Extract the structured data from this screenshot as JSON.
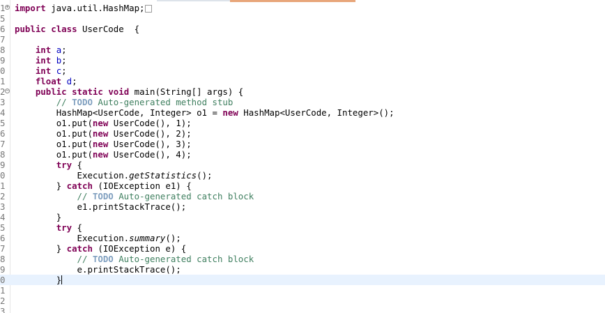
{
  "editor": {
    "line_numbers": [
      "1",
      "5",
      "6",
      "7",
      "8",
      "9",
      "0",
      "1",
      "2",
      "3",
      "4",
      "5",
      "6",
      "7",
      "8",
      "9",
      "0",
      "1",
      "2",
      "3",
      "4",
      "5",
      "6",
      "7",
      "8",
      "9",
      "0",
      "1",
      "2",
      "3"
    ],
    "fold_markers": {
      "expand": "+",
      "collapse": "−"
    },
    "current_line_index": 27,
    "code": {
      "l1": {
        "import_kw": "import",
        "import_path": " java.util.HashMap;"
      },
      "l6": {
        "public_kw": "public",
        "class_kw": "class",
        "class_name": " UserCode  {"
      },
      "l8": {
        "type": "int",
        "name": "a",
        "end": ";"
      },
      "l9": {
        "type": "int",
        "name": "b",
        "end": ";"
      },
      "l10": {
        "type": "int",
        "name": "c",
        "end": ";"
      },
      "l11": {
        "type": "float",
        "name": "d",
        "end": ";"
      },
      "l12": {
        "public_kw": "public",
        "static_kw": "static",
        "void_kw": "void",
        "signature": " main(String[] args) {"
      },
      "l13": {
        "slashes": "// ",
        "todo": "TODO",
        "text": " Auto-generated method stub"
      },
      "l14": {
        "a": "HashMap<UserCode, Integer> o1 = ",
        "new_kw": "new",
        "b": " HashMap<UserCode, Integer>();"
      },
      "l15": {
        "a": "o1.put(",
        "new_kw": "new",
        "b": " UserCode(), 1);"
      },
      "l16": {
        "a": "o1.put(",
        "new_kw": "new",
        "b": " UserCode(), 2);"
      },
      "l17": {
        "a": "o1.put(",
        "new_kw": "new",
        "b": " UserCode(), 3);"
      },
      "l18": {
        "a": "o1.put(",
        "new_kw": "new",
        "b": " UserCode(), 4);"
      },
      "l19": {
        "try_kw": "try",
        "rest": " {"
      },
      "l20": {
        "a": "Execution.",
        "method": "getStatistics",
        "b": "();"
      },
      "l21": {
        "a": "} ",
        "catch_kw": "catch",
        "b": " (IOException e1) {"
      },
      "l22": {
        "slashes": "// ",
        "todo": "TODO",
        "text": " Auto-generated catch block"
      },
      "l23": {
        "text": "e1.printStackTrace();"
      },
      "l24": {
        "text": "}"
      },
      "l25": {
        "try_kw": "try",
        "rest": " {"
      },
      "l26": {
        "a": "Execution.",
        "method": "summary",
        "b": "();"
      },
      "l27": {
        "a": "} ",
        "catch_kw": "catch",
        "b": " (IOException e) {"
      },
      "l28": {
        "slashes": "// ",
        "todo": "TODO",
        "text": " Auto-generated catch block"
      },
      "l29": {
        "text": "e.printStackTrace();"
      },
      "l30": {
        "text": "}"
      }
    }
  }
}
